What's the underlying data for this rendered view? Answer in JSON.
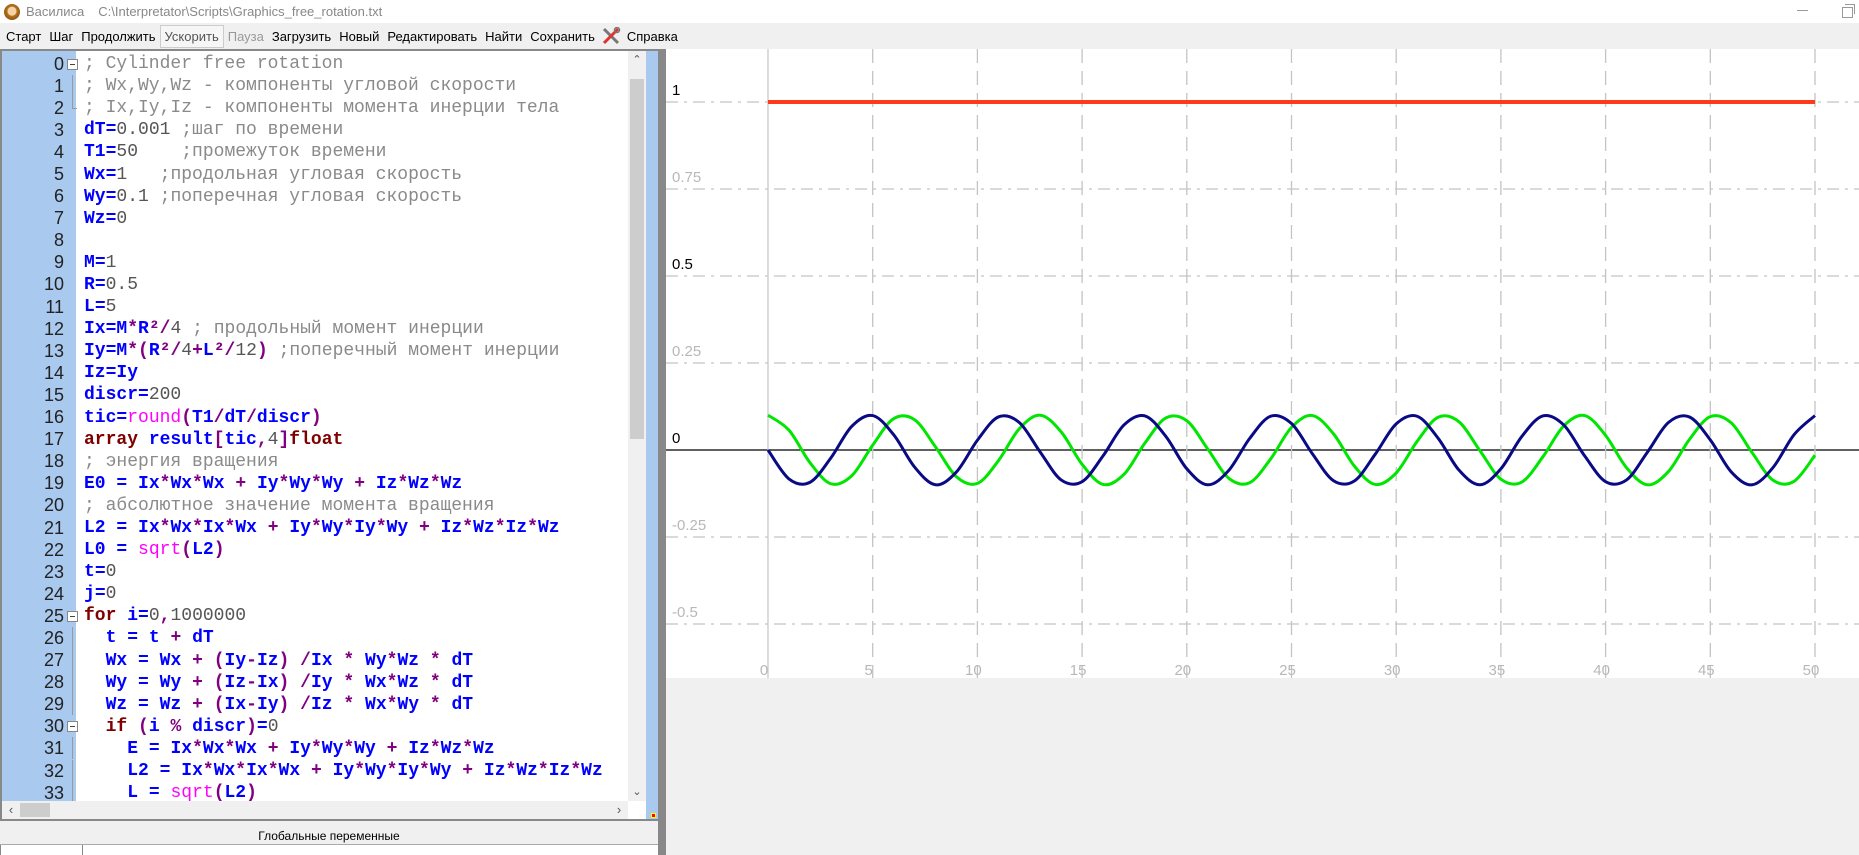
{
  "window": {
    "app_name": "Василиса",
    "file_path": "C:\\Interpretator\\Scripts\\Graphics_free_rotation.txt"
  },
  "toolbar": {
    "items": [
      {
        "label": "Старт",
        "state": "normal"
      },
      {
        "label": "Шаг",
        "state": "normal"
      },
      {
        "label": "Продолжить",
        "state": "normal"
      },
      {
        "label": "Ускорить",
        "state": "active"
      },
      {
        "label": "Пауза",
        "state": "disabled"
      },
      {
        "label": "Загрузить",
        "state": "normal"
      },
      {
        "label": "Новый",
        "state": "normal"
      },
      {
        "label": "Редактировать",
        "state": "normal"
      },
      {
        "label": "Найти",
        "state": "normal"
      },
      {
        "label": "Сохранить",
        "state": "normal"
      }
    ],
    "tools_icon": "tools-icon",
    "help_label": "Справка"
  },
  "editor": {
    "lines": [
      {
        "n": "0",
        "fold": "box",
        "text": "; Cylinder free rotation"
      },
      {
        "n": "1",
        "fold": "bar",
        "text": "; Wx,Wy,Wz - компоненты угловой скорости"
      },
      {
        "n": "2",
        "fold": "end",
        "text": "; Ix,Iy,Iz - компоненты момента инерции тела"
      },
      {
        "n": "3",
        "fold": "",
        "text": "dT=0.001 ;шаг по времени"
      },
      {
        "n": "4",
        "fold": "",
        "text": "T1=50    ;промежуток времени"
      },
      {
        "n": "5",
        "fold": "",
        "text": "Wx=1   ;продольная угловая скорость"
      },
      {
        "n": "6",
        "fold": "",
        "text": "Wy=0.1 ;поперечная угловая скорость"
      },
      {
        "n": "7",
        "fold": "",
        "text": "Wz=0"
      },
      {
        "n": "8",
        "fold": "",
        "text": ""
      },
      {
        "n": "9",
        "fold": "",
        "text": "M=1"
      },
      {
        "n": "10",
        "fold": "",
        "text": "R=0.5"
      },
      {
        "n": "11",
        "fold": "",
        "text": "L=5"
      },
      {
        "n": "12",
        "fold": "",
        "text": "Ix=M*R²/4 ; продольный момент инерции"
      },
      {
        "n": "13",
        "fold": "",
        "text": "Iy=M*(R²/4+L²/12) ;поперечный момент инерции"
      },
      {
        "n": "14",
        "fold": "",
        "text": "Iz=Iy"
      },
      {
        "n": "15",
        "fold": "",
        "text": "discr=200"
      },
      {
        "n": "16",
        "fold": "",
        "text": "tic=round(T1/dT/discr)"
      },
      {
        "n": "17",
        "fold": "",
        "text": "array result[tic,4]float"
      },
      {
        "n": "18",
        "fold": "",
        "text": "; энергия вращения"
      },
      {
        "n": "19",
        "fold": "",
        "text": "E0 = Ix*Wx*Wx + Iy*Wy*Wy + Iz*Wz*Wz"
      },
      {
        "n": "20",
        "fold": "",
        "text": "; абсолютное значение момента вращения"
      },
      {
        "n": "21",
        "fold": "",
        "text": "L2 = Ix*Wx*Ix*Wx + Iy*Wy*Iy*Wy + Iz*Wz*Iz*Wz"
      },
      {
        "n": "22",
        "fold": "",
        "text": "L0 = sqrt(L2)"
      },
      {
        "n": "23",
        "fold": "",
        "text": "t=0"
      },
      {
        "n": "24",
        "fold": "",
        "text": "j=0"
      },
      {
        "n": "25",
        "fold": "box",
        "text": "for i=0,1000000"
      },
      {
        "n": "26",
        "fold": "bar",
        "text": "  t = t + dT"
      },
      {
        "n": "27",
        "fold": "bar",
        "text": "  Wx = Wx + (Iy-Iz) /Ix * Wy*Wz * dT"
      },
      {
        "n": "28",
        "fold": "bar",
        "text": "  Wy = Wy + (Iz-Ix) /Iy * Wx*Wz * dT"
      },
      {
        "n": "29",
        "fold": "bar",
        "text": "  Wz = Wz + (Ix-Iy) /Iz * Wx*Wy * dT"
      },
      {
        "n": "30",
        "fold": "box",
        "text": "  if (i % discr)=0"
      },
      {
        "n": "31",
        "fold": "bar",
        "text": "    E = Ix*Wx*Wx + Iy*Wy*Wy + Iz*Wz*Wz"
      },
      {
        "n": "32",
        "fold": "bar",
        "text": "    L2 = Ix*Wx*Ix*Wx + Iy*Wy*Iy*Wy + Iz*Wz*Iz*Wz"
      },
      {
        "n": "33",
        "fold": "bar",
        "text": "    L = sqrt(L2)"
      }
    ],
    "keywords": [
      "array",
      "float",
      "for",
      "if"
    ],
    "functions": [
      "round",
      "sqrt"
    ]
  },
  "globals_panel": {
    "title": "Глобальные переменные"
  },
  "chart_data": {
    "type": "line",
    "title": "",
    "xlabel": "",
    "ylabel": "",
    "xlim": [
      0,
      50
    ],
    "ylim": [
      -0.62,
      1.1
    ],
    "grid": true,
    "x_ticks": [
      "0",
      "5",
      "10",
      "15",
      "20",
      "25",
      "30",
      "35",
      "40",
      "45",
      "50"
    ],
    "y_ticks": [
      {
        "value": 1,
        "label": "1",
        "emphasis": true
      },
      {
        "value": 0.75,
        "label": "0.75",
        "emphasis": false
      },
      {
        "value": 0.5,
        "label": "0.5",
        "emphasis": true
      },
      {
        "value": 0.25,
        "label": "0.25",
        "emphasis": false
      },
      {
        "value": 0,
        "label": "0",
        "emphasis": true
      },
      {
        "value": -0.25,
        "label": "-0.25",
        "emphasis": false
      },
      {
        "value": -0.5,
        "label": "-0.5",
        "emphasis": false
      }
    ],
    "series": [
      {
        "name": "red",
        "color": "#ff3a1a",
        "x": [
          0,
          50
        ],
        "values": [
          1,
          1
        ]
      },
      {
        "name": "green",
        "color": "#00e600",
        "x_start": 0,
        "x_step": 1,
        "values": [
          0.1,
          0.057,
          -0.036,
          -0.097,
          -0.074,
          0.014,
          0.09,
          0.087,
          0.009,
          -0.077,
          -0.096,
          -0.031,
          0.061,
          0.1,
          0.052,
          -0.041,
          -0.099,
          -0.07,
          0.02,
          0.092,
          0.084,
          0.003,
          -0.081,
          -0.094,
          -0.026,
          0.065,
          0.099,
          0.047,
          -0.046,
          -0.099,
          -0.066,
          0.025,
          0.094,
          0.081,
          -0.002,
          -0.084,
          -0.092,
          -0.02,
          0.069,
          0.099,
          0.042,
          -0.051,
          -0.1,
          -0.062,
          0.03,
          0.096,
          0.078,
          -0.008,
          -0.087,
          -0.09,
          -0.015
        ]
      },
      {
        "name": "navy",
        "color": "#0a0a85",
        "x_start": 0,
        "x_step": 1,
        "values": [
          0,
          -0.083,
          -0.093,
          -0.023,
          0.068,
          0.099,
          0.044,
          -0.049,
          -0.1,
          -0.063,
          0.028,
          0.095,
          0.079,
          -0.006,
          -0.086,
          -0.091,
          -0.017,
          0.072,
          0.098,
          0.039,
          -0.054,
          -0.1,
          -0.059,
          0.033,
          0.097,
          0.076,
          -0.011,
          -0.088,
          -0.089,
          -0.012,
          0.075,
          0.097,
          0.034,
          -0.058,
          -0.1,
          -0.054,
          0.039,
          0.098,
          0.072,
          -0.017,
          -0.091,
          -0.086,
          -0.006,
          0.079,
          0.095,
          0.029,
          -0.063,
          -0.1,
          -0.05,
          0.044,
          0.099
        ]
      }
    ]
  }
}
